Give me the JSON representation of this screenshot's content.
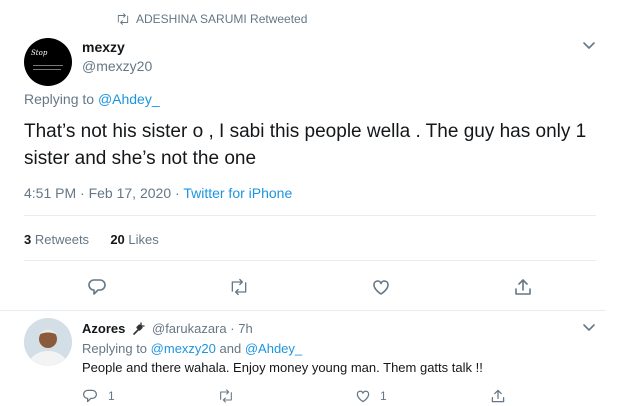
{
  "retweet_header": {
    "text": "ADESHINA SARUMI Retweeted"
  },
  "tweet": {
    "author_name": "mexzy",
    "author_handle": "@mexzy20",
    "avatar_text": "Stop",
    "replying_label": "Replying to",
    "replying_to": "@Ahdey_",
    "text": "That’s not his sister o , I sabi this people wella . The guy has only 1 sister and she’s not the one",
    "time": "4:51 PM",
    "date": "Feb 17, 2020",
    "separator": "·",
    "source": "Twitter for iPhone",
    "retweets_count": "3",
    "retweets_label": "Retweets",
    "likes_count": "20",
    "likes_label": "Likes"
  },
  "reply": {
    "author_name": "Azores",
    "author_handle": "@farukazara",
    "separator": "·",
    "time": "7h",
    "replying_label": "Replying to",
    "mention1": "@mexzy20",
    "and_label": "and",
    "mention2": "@Ahdey_",
    "text": "People and there wahala. Enjoy money young man. Them gatts talk !!",
    "reply_count": "1",
    "like_count": "1"
  },
  "colors": {
    "accent": "#1b95e0",
    "muted": "#657786",
    "text": "#14171a",
    "divider": "#e6ecf0"
  },
  "icons": [
    "retweet-icon",
    "chevron-down-icon",
    "reply-icon",
    "like-icon",
    "share-icon",
    "plug-emoji-icon"
  ]
}
